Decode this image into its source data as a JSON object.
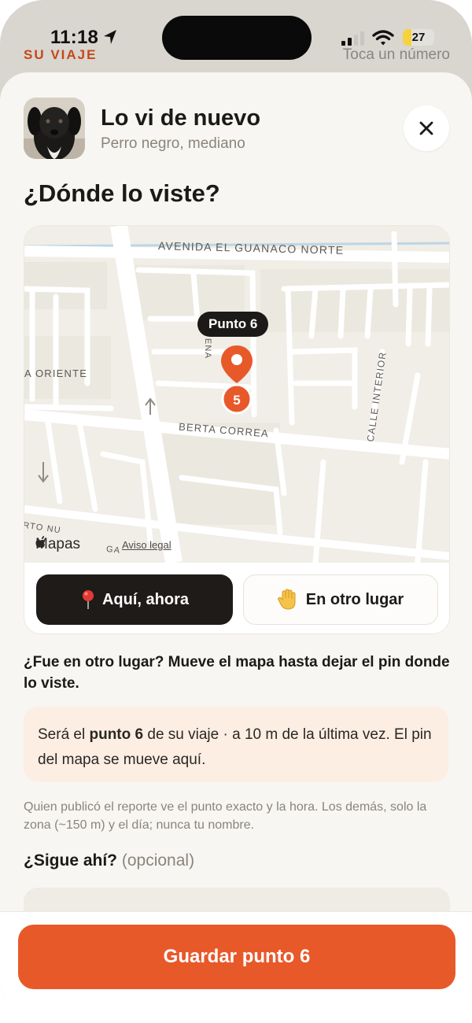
{
  "status_bar": {
    "time": "11:18",
    "battery": "27",
    "battery_level": 0.27,
    "background_left": "SU VIAJE",
    "background_right": "Toca un número"
  },
  "header": {
    "title": "Lo vi de nuevo",
    "subtitle": "Perro negro, mediano"
  },
  "question": "¿Dónde lo viste?",
  "map": {
    "streets": {
      "avenida": "AVENIDA EL GUANACO NORTE",
      "oriente": "A ORIENTE",
      "berta": "BERTA CORREA",
      "calle_interior": "CALLE INTERIOR",
      "ena": "ENA",
      "bottom_left": "RTO NU",
      "bottom_ga": "GA"
    },
    "pin_label": "Punto 6",
    "pin_number": "5",
    "maps_brand": "Mapas",
    "legal": "Aviso legal"
  },
  "buttons": {
    "here": "Aquí, ahora",
    "other": "En otro lugar",
    "save": "Guardar punto 6"
  },
  "instruction": "¿Fue en otro lugar? Mueve el mapa hasta dejar el pin donde lo viste.",
  "info": {
    "prefix": "Será el ",
    "bold": "punto 6",
    "suffix": " de su viaje · a 10 m de la última vez. El pin del mapa se mueve aquí."
  },
  "privacy": "Quien publicó el reporte ve el punto exacto y la hora. Los demás, solo la zona (~150 m) y el día; nunca tu nombre.",
  "sigue": {
    "label": "¿Sigue ahí?",
    "optional": "(opcional)"
  },
  "colors": {
    "accent": "#e8592a",
    "pin": "#e8592a",
    "dark": "#1e1b19",
    "info_bg": "#fdeee3"
  },
  "icons": [
    "location-arrow-icon",
    "signal-icon",
    "wifi-icon",
    "battery-icon",
    "close-icon",
    "map-pin-icon",
    "pushpin-icon",
    "raised-hand-icon",
    "apple-logo-icon"
  ]
}
